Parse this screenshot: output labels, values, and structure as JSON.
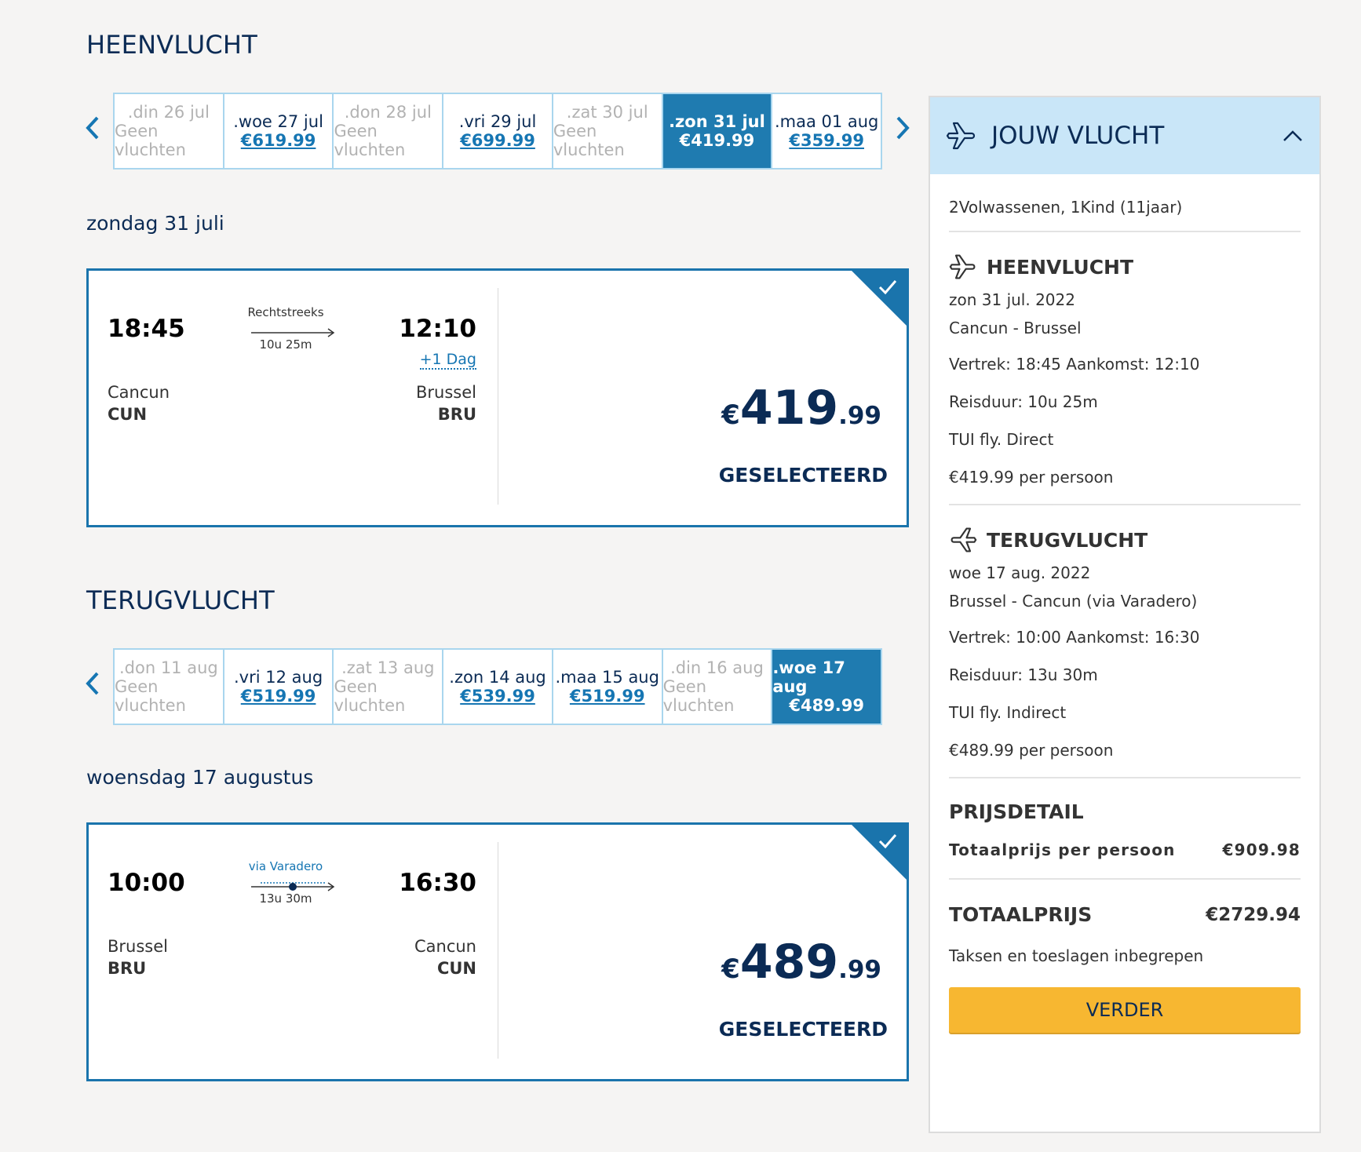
{
  "outbound": {
    "title": "HEENVLUCHT",
    "days": [
      {
        "label": ".din 26 jul",
        "price": "Geen vluchten",
        "state": "none"
      },
      {
        "label": ".woe 27 jul",
        "price": "€619.99",
        "state": "avail"
      },
      {
        "label": ".don 28 jul",
        "price": "Geen vluchten",
        "state": "none"
      },
      {
        "label": ".vri 29 jul",
        "price": "€699.99",
        "state": "avail"
      },
      {
        "label": ".zat 30 jul",
        "price": "Geen vluchten",
        "state": "none"
      },
      {
        "label": ".zon 31 jul",
        "price": "€419.99",
        "state": "selected"
      },
      {
        "label": ".maa 01 aug",
        "price": "€359.99",
        "state": "avail"
      }
    ],
    "date_label": "zondag 31 juli",
    "flight": {
      "dep_time": "18:45",
      "arr_time": "12:10",
      "type": "Rechtstreeks",
      "duration": "10u 25m",
      "plus_day": "+1 Dag",
      "dep_city": "Cancun",
      "dep_code": "CUN",
      "arr_city": "Brussel",
      "arr_code": "BRU",
      "price_currency": "€",
      "price_int": "419",
      "price_dec": ".99",
      "status": "GESELECTEERD"
    }
  },
  "return": {
    "title": "TERUGVLUCHT",
    "days": [
      {
        "label": ".don 11 aug",
        "price": "Geen vluchten",
        "state": "none"
      },
      {
        "label": ".vri 12 aug",
        "price": "€519.99",
        "state": "avail"
      },
      {
        "label": ".zat 13 aug",
        "price": "Geen vluchten",
        "state": "none"
      },
      {
        "label": ".zon 14 aug",
        "price": "€539.99",
        "state": "avail"
      },
      {
        "label": ".maa 15 aug",
        "price": "€519.99",
        "state": "avail"
      },
      {
        "label": ".din 16 aug",
        "price": "Geen vluchten",
        "state": "none"
      },
      {
        "label": ".woe 17 aug",
        "price": "€489.99",
        "state": "selected"
      }
    ],
    "date_label": "woensdag 17 augustus",
    "flight": {
      "dep_time": "10:00",
      "arr_time": "16:30",
      "type": "via Varadero",
      "duration": "13u 30m",
      "dep_city": "Brussel",
      "dep_code": "BRU",
      "arr_city": "Cancun",
      "arr_code": "CUN",
      "price_currency": "€",
      "price_int": "489",
      "price_dec": ".99",
      "status": "GESELECTEERD"
    }
  },
  "sidebar": {
    "title": "JOUW VLUCHT",
    "passengers": "2Volwassenen, 1Kind (11jaar)",
    "outbound": {
      "heading": "HEENVLUCHT",
      "date": "zon 31 jul. 2022",
      "route": "Cancun - Brussel",
      "times": "Vertrek: 18:45 Aankomst: 12:10",
      "duration": "Reisduur: 10u 25m",
      "carrier": "TUI fly. Direct",
      "price": "€419.99 per persoon"
    },
    "return": {
      "heading": "TERUGVLUCHT",
      "date": "woe 17 aug. 2022",
      "route": "Brussel - Cancun (via Varadero)",
      "times": "Vertrek: 10:00 Aankomst: 16:30",
      "duration": "Reisduur: 13u 30m",
      "carrier": "TUI fly. Indirect",
      "price": "€489.99 per persoon"
    },
    "price_detail": {
      "heading": "PRIJSDETAIL",
      "label": "Totaalprijs per persoon",
      "value": "€909.98"
    },
    "total": {
      "label": "TOTAALPRIJS",
      "value": "€2729.94",
      "note": "Taksen en toeslagen inbegrepen"
    },
    "button": "VERDER"
  },
  "icons": {
    "prev": "chevron-left-icon",
    "next": "chevron-right-icon",
    "plane": "plane-icon",
    "collapse": "chevron-up-icon",
    "check": "check-icon"
  },
  "colors": {
    "navy": "#0b2b55",
    "selected_blue": "#1f7bb0",
    "link_blue": "#1676b3",
    "header_blue": "#c9e6f8",
    "button_yellow": "#f7b731",
    "background": "#f5f4f3"
  }
}
